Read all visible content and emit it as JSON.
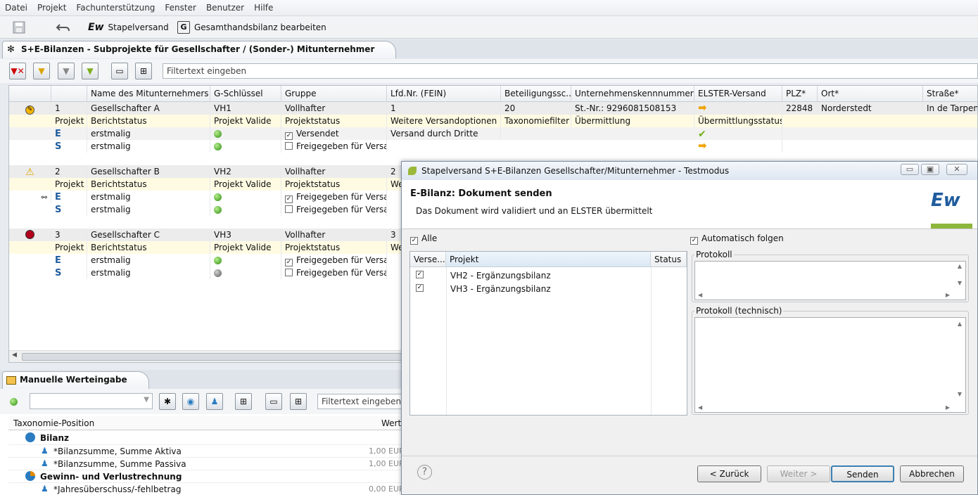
{
  "menu": [
    "Datei",
    "Projekt",
    "Fachunterstützung",
    "Fenster",
    "Benutzer",
    "Hilfe"
  ],
  "toolbar": {
    "stapel_label": "Stapelversand",
    "gesamt_label": "Gesamthandsbilanz bearbeiten",
    "save_icon": "save-icon",
    "undo_icon": "undo-icon"
  },
  "view": {
    "title": "S+E-Bilanzen - Subprojekte für Gesellschafter / (Sonder-) Mitunternehmer",
    "filter_placeholder": "Filtertext eingeben"
  },
  "grid": {
    "headers": [
      "Name des Mitunternehmers",
      "G-Schlüssel",
      "Gruppe",
      "Lfd.Nr. (FEIN)",
      "Beteiligungssc...",
      "Unternehmenskennnummern",
      "ELSTER-Versand",
      "PLZ*",
      "Ort*",
      "Straße*"
    ],
    "rows": [
      {
        "c1": "1",
        "name": "Gesellschafter A",
        "g": "VH1",
        "gruppe": "Vollhafter",
        "lfd": "1",
        "bet": "20",
        "ukn": "St.-Nr.: 9296081508153",
        "plz": "22848",
        "ort": "Norderstedt",
        "str": "In de Tarpen"
      },
      {
        "c1": "Projekt",
        "name": "Berichtstatus",
        "g": "Projekt Valide",
        "gruppe": "Projektstatus",
        "lfd": "Weitere Versandoptionen",
        "bet": "Taxonomiefilter",
        "ukn": "Übermittlung",
        "elster": "Übermittlungsstatus"
      },
      {
        "c1": "E",
        "name": "erstmalig",
        "gruppe": "Versendet",
        "lfd": "Versand durch Dritte"
      },
      {
        "c1": "S",
        "name": "erstmalig",
        "gruppe": "Freigegeben für Versa..."
      },
      {
        "c1": "2",
        "name": "Gesellschafter B",
        "g": "VH2",
        "gruppe": "Vollhafter",
        "lfd": "2"
      },
      {
        "c1": "Projekt",
        "name": "Berichtstatus",
        "g": "Projekt Valide",
        "gruppe": "Projektstatus",
        "lfd": "We"
      },
      {
        "c1": "E",
        "name": "erstmalig",
        "gruppe": "Freigegeben für Versa..."
      },
      {
        "c1": "S",
        "name": "erstmalig",
        "gruppe": "Freigegeben für Versa..."
      },
      {
        "c1": "3",
        "name": "Gesellschafter C",
        "g": "VH3",
        "gruppe": "Vollhafter",
        "lfd": "3"
      },
      {
        "c1": "Projekt",
        "name": "Berichtstatus",
        "g": "Projekt Valide",
        "gruppe": "Projektstatus",
        "lfd": "We"
      },
      {
        "c1": "E",
        "name": "erstmalig",
        "gruppe": "Freigegeben für Versa..."
      },
      {
        "c1": "S",
        "name": "erstmalig",
        "gruppe": "Freigegeben für Versa..."
      }
    ]
  },
  "lower": {
    "title": "Manuelle Werteingabe",
    "filter_placeholder": "Filtertext eingeben",
    "col_pos": "Taxonomie-Position",
    "col_wert": "Wert",
    "items": [
      {
        "label": "Bilanz",
        "value": ""
      },
      {
        "label": "*Bilanzsumme, Summe Aktiva",
        "value": "1,00 EUR"
      },
      {
        "label": "*Bilanzsumme, Summe Passiva",
        "value": "1,00 EUR"
      },
      {
        "label": "Gewinn- und Verlustrechnung",
        "value": ""
      },
      {
        "label": "*Jahresüberschuss/-fehlbetrag",
        "value": "0,00 EUR"
      }
    ]
  },
  "dialog": {
    "title": "Stapelversand S+E-Bilanzen Gesellschafter/Mitunternehmer - Testmodus",
    "heading": "E-Bilanz: Dokument senden",
    "desc": "Das Dokument wird validiert und an ELSTER übermittelt",
    "alle": "Alle",
    "auto": "Automatisch folgen",
    "col_verse": "Verse...",
    "col_projekt": "Projekt",
    "col_status": "Status",
    "items": [
      "VH2 - Ergänzungsbilanz",
      "VH3 - Ergänzungsbilanz"
    ],
    "protokoll": "Protokoll",
    "protokoll_tech": "Protokoll (technisch)",
    "buttons": {
      "back": "< Zurück",
      "next": "Weiter >",
      "send": "Senden",
      "cancel": "Abbrechen"
    },
    "help": "?"
  },
  "colors": {
    "accent": "#8db63c",
    "brand": "#1f5c9e"
  }
}
